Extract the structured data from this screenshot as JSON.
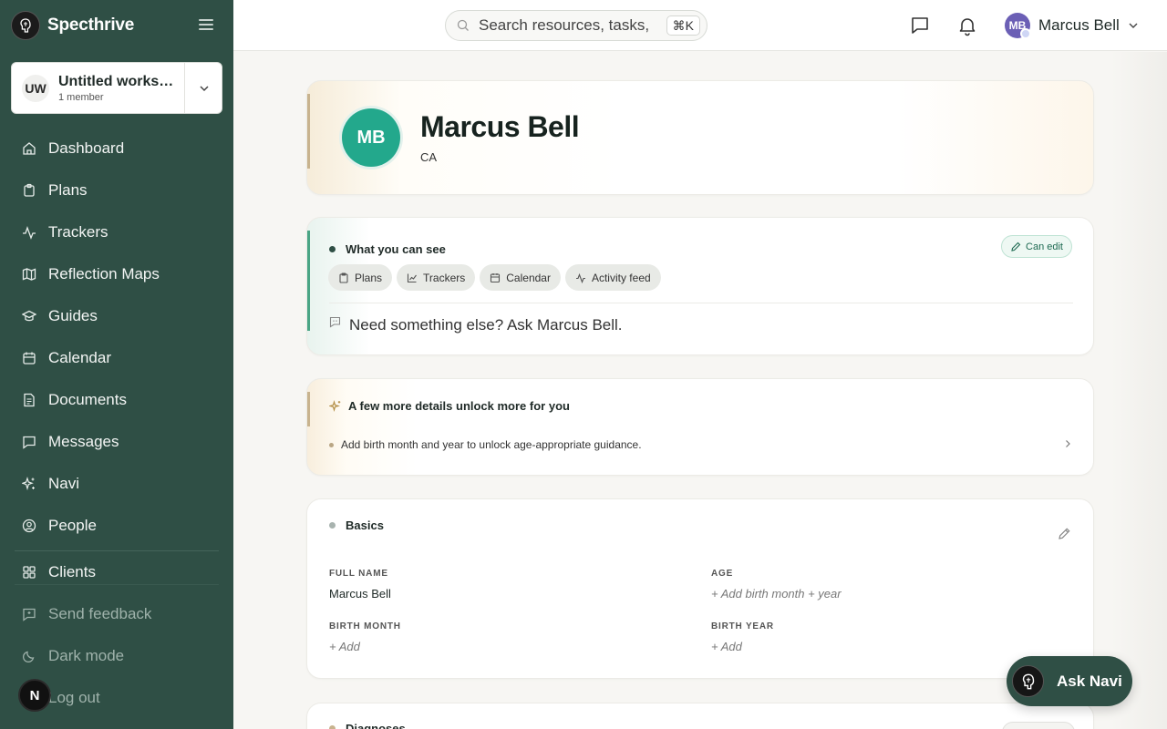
{
  "app": {
    "name": "Specthrive"
  },
  "workspace": {
    "initials": "UW",
    "name": "Untitled workspace",
    "members": "1 member"
  },
  "nav": {
    "items": [
      {
        "label": "Dashboard",
        "icon": "home-icon"
      },
      {
        "label": "Plans",
        "icon": "clipboard-icon"
      },
      {
        "label": "Trackers",
        "icon": "activity-icon"
      },
      {
        "label": "Reflection Maps",
        "icon": "map-icon"
      },
      {
        "label": "Guides",
        "icon": "graduation-cap-icon"
      },
      {
        "label": "Calendar",
        "icon": "calendar-icon"
      },
      {
        "label": "Documents",
        "icon": "document-icon"
      },
      {
        "label": "Messages",
        "icon": "message-icon"
      },
      {
        "label": "Navi",
        "icon": "sparkles-icon"
      },
      {
        "label": "People",
        "icon": "person-circle-icon"
      },
      {
        "label": "Clients",
        "icon": "grid-icon"
      }
    ],
    "bottom": [
      {
        "label": "Send feedback",
        "icon": "feedback-icon"
      },
      {
        "label": "Dark mode",
        "icon": "moon-icon"
      },
      {
        "label": "Log out",
        "icon": "logout-icon"
      }
    ],
    "badge": "N"
  },
  "topbar": {
    "search_placeholder": "Search resources, tasks, people",
    "shortcut": "⌘K",
    "user": {
      "initials": "MB",
      "name": "Marcus Bell"
    }
  },
  "profile": {
    "initials": "MB",
    "name": "Marcus Bell",
    "subtitle": "CA"
  },
  "visibility": {
    "title": "What you can see",
    "can_edit": "Can edit",
    "chips": [
      {
        "label": "Plans",
        "icon": "clipboard-icon"
      },
      {
        "label": "Trackers",
        "icon": "chart-icon"
      },
      {
        "label": "Calendar",
        "icon": "calendar-icon"
      },
      {
        "label": "Activity feed",
        "icon": "activity-icon"
      }
    ],
    "ask_text": "Need something else? Ask Marcus Bell."
  },
  "unlock": {
    "title": "A few more details unlock more for you",
    "item": "Add birth month and year to unlock age-appropriate guidance."
  },
  "basics": {
    "title": "Basics",
    "full_name_label": "FULL NAME",
    "full_name": "Marcus Bell",
    "age_label": "AGE",
    "age_add": "+ Add birth month + year",
    "birth_month_label": "BIRTH MONTH",
    "birth_month_add": "+ Add",
    "birth_year_label": "BIRTH YEAR",
    "birth_year_add": "+ Add"
  },
  "diagnoses": {
    "title": "Diagnoses"
  },
  "ask_navi": {
    "label": "Ask Navi"
  },
  "colors": {
    "sidebar": "#2f4f45",
    "accent_green": "#23a88c",
    "user_avatar": "#6b5fb5"
  }
}
